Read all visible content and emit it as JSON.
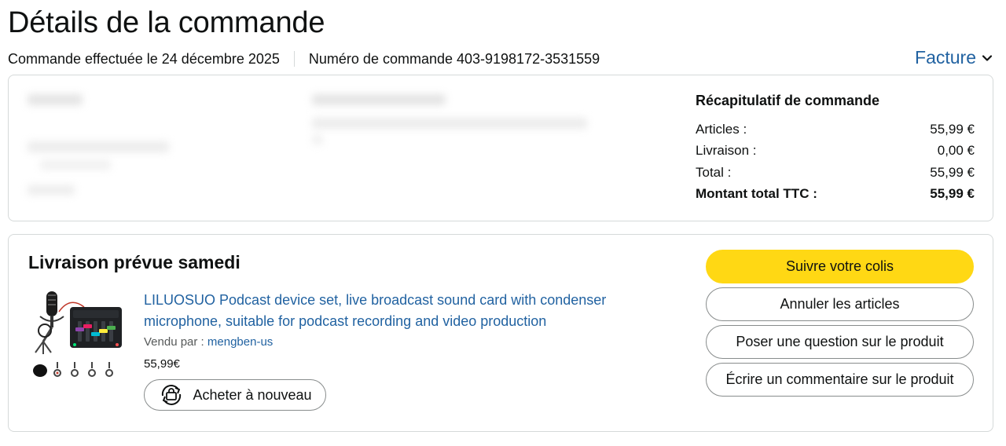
{
  "header": {
    "title": "Détails de la commande",
    "order_date": "Commande effectuée le 24 décembre 2025",
    "order_number": "Numéro de commande 403-9198172-3531559",
    "invoice_label": "Facture"
  },
  "summary": {
    "title": "Récapitulatif de commande",
    "rows": [
      {
        "label": "Articles :",
        "value": "55,99 €"
      },
      {
        "label": "Livraison :",
        "value": "0,00 €"
      },
      {
        "label": "Total :",
        "value": "55,99 €"
      },
      {
        "label": "Montant total TTC :",
        "value": "55,99 €"
      }
    ]
  },
  "delivery": {
    "title": "Livraison prévue samedi",
    "product_title": "LILUOSUO Podcast device set, live broadcast sound card with condenser microphone, suitable for podcast recording and video production",
    "seller_prefix": "Vendu par  : ",
    "seller_name": "mengben-us",
    "price": "55,99€",
    "buy_again_label": "Acheter à nouveau"
  },
  "actions": {
    "track": "Suivre votre colis",
    "cancel": "Annuler les articles",
    "question": "Poser une question sur le produit",
    "review": "Écrire un commentaire sur le produit"
  },
  "colors": {
    "link": "#2162a1",
    "primary_button": "#ffd814",
    "border": "#d5d9d9"
  }
}
